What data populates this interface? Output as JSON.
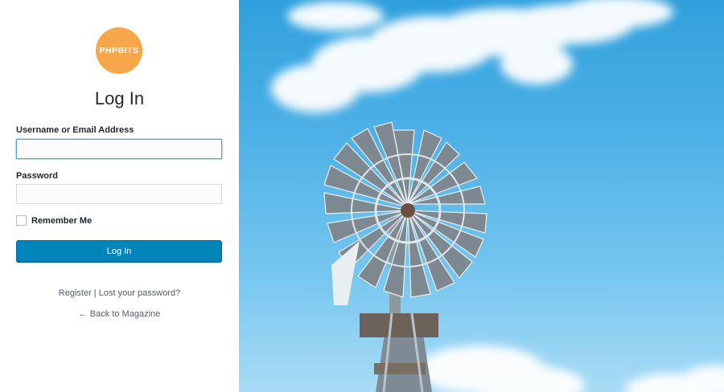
{
  "logo": {
    "text": "PHPBITS",
    "color": "#f7a64a"
  },
  "form": {
    "title": "Log In",
    "username_label": "Username or Email Address",
    "username_value": "",
    "password_label": "Password",
    "password_value": "",
    "remember_label": "Remember Me",
    "remember_checked": false,
    "submit_label": "Log In",
    "accent_color": "#0085ba"
  },
  "nav": {
    "register_label": "Register",
    "separator": "|",
    "lost_password_label": "Lost your password?",
    "back_label": "← Back to Magazine"
  }
}
